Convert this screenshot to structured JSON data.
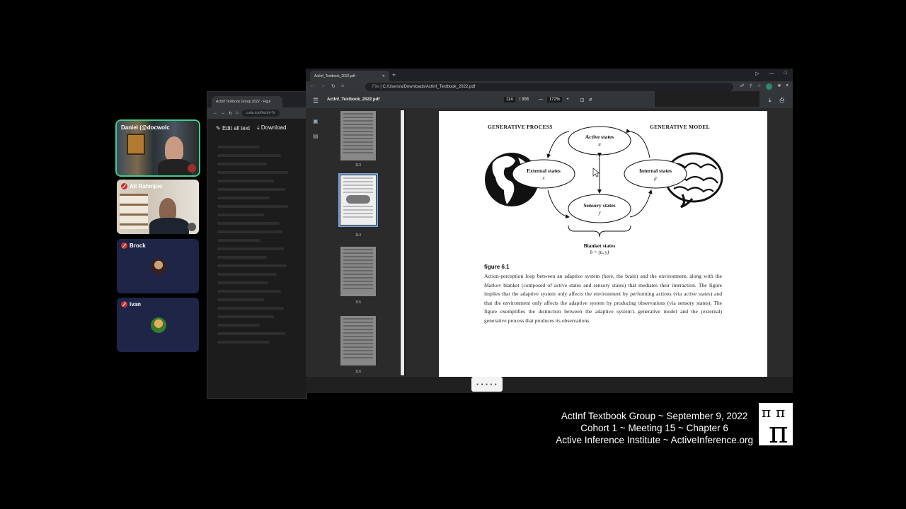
{
  "participants": [
    {
      "name": "Daniel (@docwolc",
      "muted": false,
      "video": true
    },
    {
      "name": "Ali Rahmjoo",
      "muted": true,
      "video": true
    },
    {
      "name": "Brock",
      "muted": true,
      "video": false
    },
    {
      "name": "ivan",
      "muted": true,
      "video": false
    }
  ],
  "back_window": {
    "tab_title": "ActInf Textbook Group 2022 - Figur",
    "url": "coda.io/d/ActInf-Te",
    "edit_label": "Edit all text",
    "download_label": "Download"
  },
  "browser": {
    "tab_title": "ActInf_Textbook_2022.pdf",
    "url": "C:/Users/a/Downloads/ActInf_Textbook_2022.pdf",
    "url_prefix": "File",
    "profile_initial": "Z"
  },
  "pdf": {
    "file_name": "ActInf_Textbook_2022.pdf",
    "current_page": "114",
    "total_pages": "/ 308",
    "zoom": "172%",
    "thumbnail_labels": [
      "113",
      "114",
      "115",
      "116"
    ],
    "selected_thumbnail": "114"
  },
  "figure": {
    "generative_process": "GENERATIVE PROCESS",
    "generative_model": "GENERATIVE MODEL",
    "active_states": "Active states",
    "active_symbol": "u",
    "external_states": "External states",
    "external_symbol": "x",
    "internal_states": "Internal states",
    "internal_symbol": "μ",
    "sensory_states": "Sensory states",
    "sensory_symbol": "y",
    "blanket_states": "Blanket states",
    "blanket_formula": "b = (u, y)",
    "caption_title": "figure 6.1",
    "caption_text": "Action-perception loop between an adaptive system (here, the brain) and the environment, along with the Markov blanket (composed of active states and sensory states) that mediates their interaction. The figure implies that the adaptive system only affects the environment by performing actions (via active states) and that the environment only affects the adaptive system by producing observations (via sensory states). The figure exemplifies the distinction between the adaptive system's generative model and the (external) generative process that produces its observations."
  },
  "footer": {
    "line1": "ActInf Textbook Group ~ September 9, 2022",
    "line2": "Cohort 1 ~ Meeting 15 ~ Chapter 6",
    "line3": "Active Inference Institute ~ ActiveInference.org"
  },
  "colors": {
    "background": "#000000",
    "tile_bg": "#1e2547",
    "active_speaker": "#3fd08d",
    "muted": "#cc3333",
    "selection": "#7aa7e0"
  }
}
